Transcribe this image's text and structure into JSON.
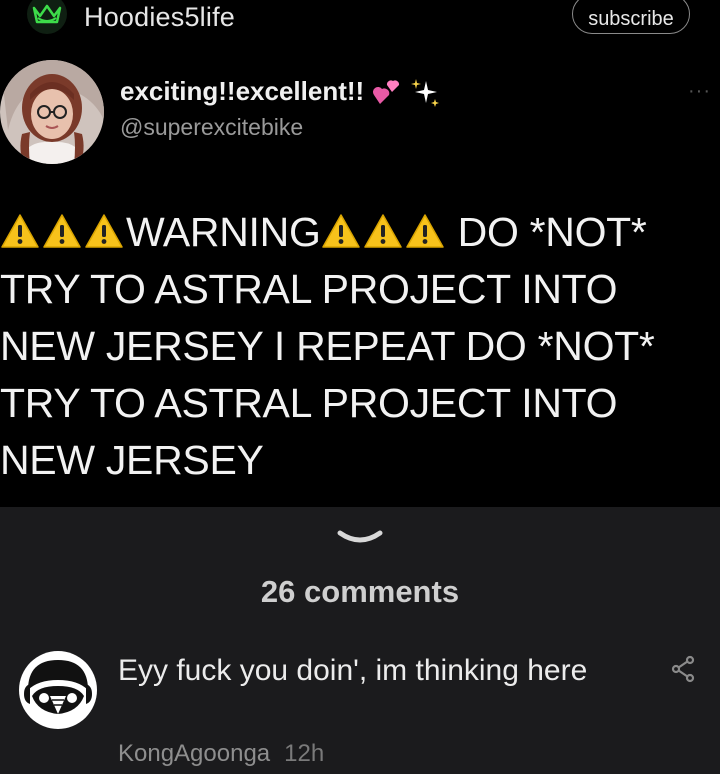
{
  "header": {
    "community_name": "Hoodies5life",
    "subscribe_label": "subscribe",
    "icon": "crown-icon",
    "accent_color": "#2ecc40"
  },
  "tweet": {
    "display_name": "exciting!!excellent!!",
    "display_name_emojis": [
      "two-hearts-emoji",
      "sparkles-emoji"
    ],
    "handle": "@superexcitebike",
    "more_icon": "more-dots-icon",
    "warning_icon": "warning-sign-emoji",
    "segments": {
      "warning_word": "WARNING",
      "rest": " DO *NOT* TRY TO ASTRAL PROJECT INTO NEW JERSEY I REPEAT DO *NOT* TRY TO ASTRAL PROJECT INTO NEW JERSEY"
    }
  },
  "comments_section": {
    "expand_icon": "chevron-down-icon",
    "count_label": "26 comments",
    "comments": [
      {
        "text": "Eyy fuck you doin', im thinking here",
        "author": "KongAgoonga",
        "time": "12h",
        "action_icon": "share-icon"
      }
    ]
  },
  "colors": {
    "background_top": "#000000",
    "background_bottom": "#1b1b1d",
    "warning_yellow": "#f7c21b"
  }
}
